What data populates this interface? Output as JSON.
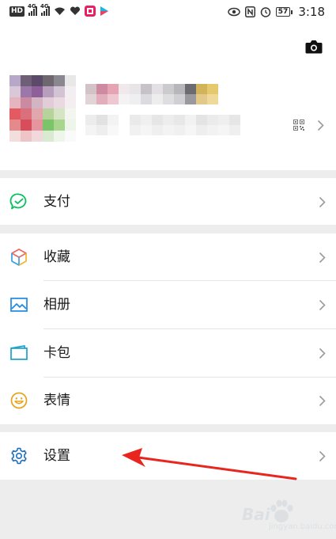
{
  "status_bar": {
    "hd_label": "HD",
    "network_left": "4G",
    "network_right": "4G",
    "time": "3:18",
    "battery": "57"
  },
  "profile": {
    "camera_icon": "camera-icon",
    "qr_icon": "qr-code-icon"
  },
  "menu": {
    "pay_label": "支付",
    "favorites_label": "收藏",
    "album_label": "相册",
    "cards_label": "卡包",
    "stickers_label": "表情",
    "settings_label": "设置"
  },
  "colors": {
    "pay_icon": "#07c160",
    "album_icon": "#1e88e5",
    "cards_icon": "#1aa3c9",
    "stickers_icon": "#e3a51d",
    "settings_icon": "#1e6fbf",
    "arrow": "#e8261f"
  },
  "watermark": {
    "text": "Bai",
    "sub": "jingyan.baidu.com"
  }
}
